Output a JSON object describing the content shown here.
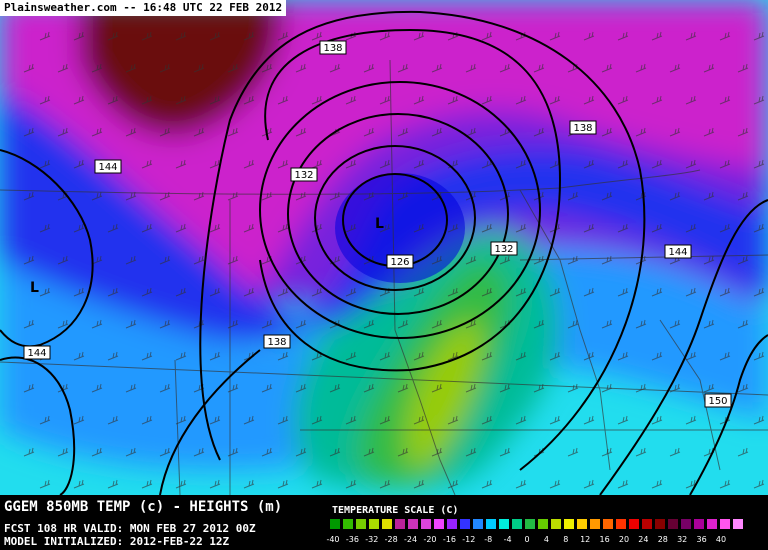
{
  "header": {
    "site": "Plainsweather.com",
    "sep": " -- ",
    "time": "16:48 UTC 22 FEB 2012"
  },
  "footer": {
    "title": "GGEM 850MB TEMP (c) - HEIGHTS (m)",
    "fcst_label": "FCST 108 HR VALID:",
    "fcst_value": "MON FEB 27 2012 00Z",
    "model_label": "MODEL INITIALIZED:",
    "model_value": "2012-FEB-22 12Z"
  },
  "legend": {
    "title": "TEMPERATURE SCALE (C)",
    "ticks": [
      "-40",
      "-36",
      "-32",
      "-28",
      "-24",
      "-20",
      "-16",
      "-12",
      "-8",
      "-4",
      "0",
      "4",
      "8",
      "12",
      "16",
      "20",
      "24",
      "28",
      "32",
      "36",
      "40"
    ],
    "colors": [
      "#009900",
      "#33bb00",
      "#77cc00",
      "#aadd00",
      "#dddd00",
      "#bb2299",
      "#cc33bb",
      "#dd44dd",
      "#ee44ff",
      "#9922ff",
      "#3333ff",
      "#2288ff",
      "#00ccff",
      "#00eedd",
      "#00cc88",
      "#22bb44",
      "#66cc00",
      "#bbdd00",
      "#eeee00",
      "#ffcc00",
      "#ff9900",
      "#ff6600",
      "#ff3300",
      "#ee0000",
      "#bb0000",
      "#880000",
      "#660033",
      "#770066",
      "#aa0099",
      "#dd22cc",
      "#ff55ee",
      "#ff88ff"
    ]
  },
  "map": {
    "contour_labels": [
      "138",
      "138",
      "144",
      "132",
      "132",
      "126",
      "138",
      "144",
      "144",
      "150"
    ],
    "low_labels": [
      "L",
      "L"
    ]
  }
}
